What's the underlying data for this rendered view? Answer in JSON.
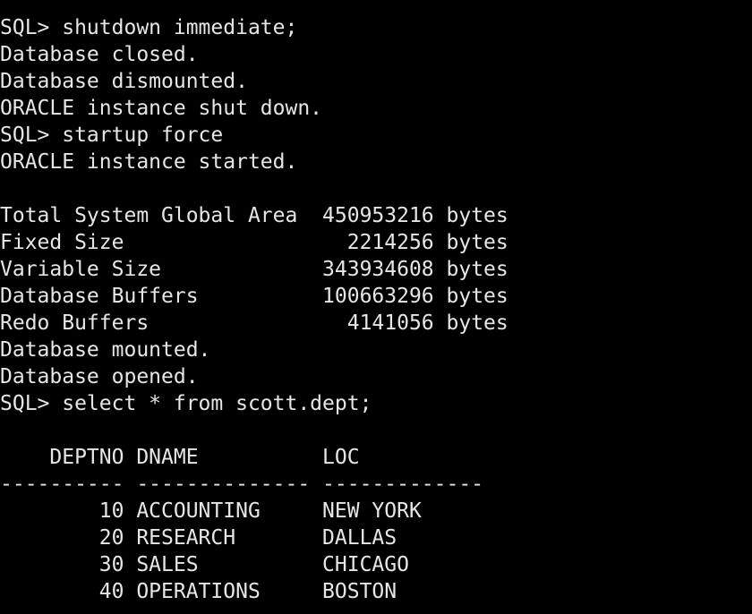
{
  "terminal": {
    "lines": [
      "SQL> shutdown immediate;",
      "Database closed.",
      "Database dismounted.",
      "ORACLE instance shut down.",
      "SQL> startup force",
      "ORACLE instance started.",
      "",
      "Total System Global Area  450953216 bytes",
      "Fixed Size                  2214256 bytes",
      "Variable Size             343934608 bytes",
      "Database Buffers          100663296 bytes",
      "Redo Buffers                4141056 bytes",
      "Database mounted.",
      "Database opened.",
      "SQL> select * from scott.dept;",
      "",
      "    DEPTNO DNAME          LOC",
      "---------- -------------- -------------",
      "        10 ACCOUNTING     NEW YORK",
      "        20 RESEARCH       DALLAS",
      "        30 SALES          CHICAGO",
      "        40 OPERATIONS     BOSTON"
    ]
  }
}
